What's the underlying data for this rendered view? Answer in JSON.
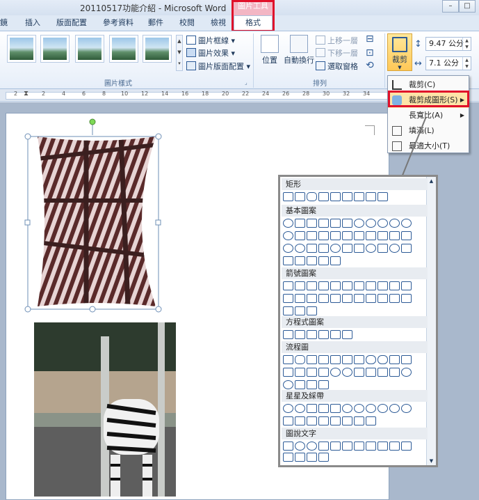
{
  "window": {
    "title": "20110517功能介紹 - Microsoft Word",
    "context_tab_group": "圖片工具",
    "min_btn": "–",
    "max_btn": "□"
  },
  "tabs": [
    "鏡",
    "插入",
    "版面配置",
    "參考資料",
    "郵件",
    "校閱",
    "檢視",
    "格式"
  ],
  "ribbon": {
    "picture_styles_group": "圖片樣式",
    "border_btn": "圖片框線",
    "effects_btn": "圖片效果",
    "layout_btn": "圖片版面配置",
    "arrange_group": "排列",
    "position_btn": "位置",
    "wrap_btn": "自動換行",
    "bring_forward": "上移一層",
    "send_backward": "下移一層",
    "selection_pane": "選取窗格",
    "crop_btn": "裁剪",
    "height_value": "9.47 公分",
    "width_value": "7.1 公分"
  },
  "ruler_ticks": [
    "2",
    "2",
    "4",
    "6",
    "8",
    "10",
    "12",
    "14",
    "16",
    "18",
    "20",
    "22",
    "24",
    "26",
    "28",
    "30",
    "32",
    "34"
  ],
  "crop_menu": {
    "items": [
      "裁剪(C)",
      "裁剪成圖形(S)",
      "長寬比(A)",
      "填滿(L)",
      "最適大小(T)"
    ]
  },
  "shapes_gallery": {
    "sections": [
      "矩形",
      "基本圖案",
      "箭號圖案",
      "方程式圖案",
      "流程圖",
      "星星及綵帶",
      "圖說文字"
    ]
  }
}
